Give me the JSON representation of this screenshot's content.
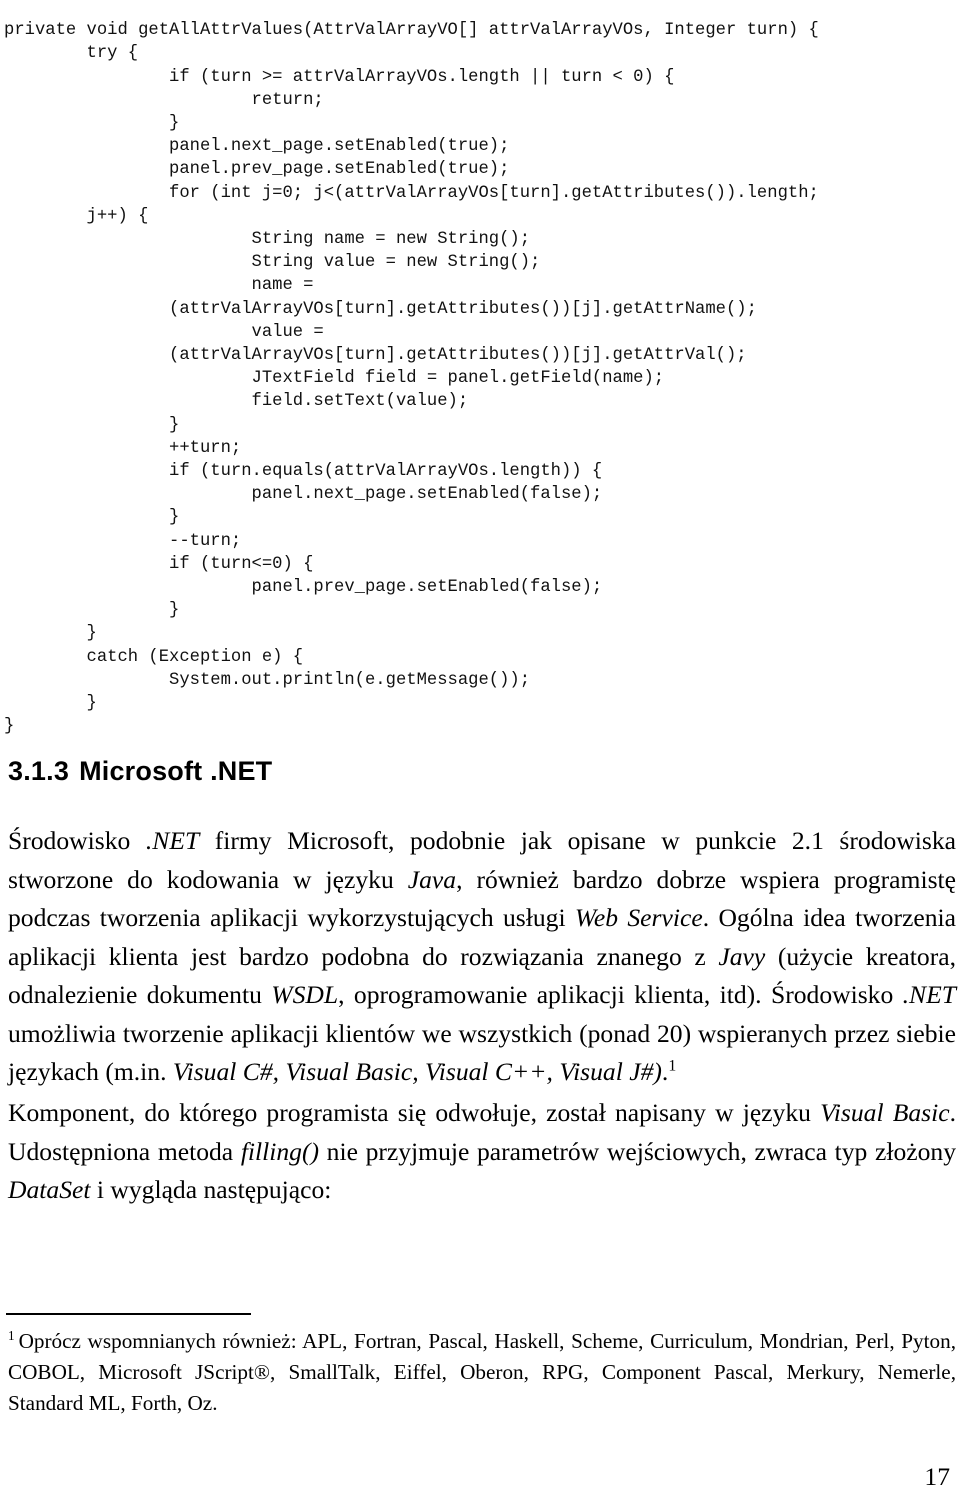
{
  "document": {
    "page_number": "17"
  },
  "code_listing": {
    "language": "java",
    "lines": [
      "private void getAllAttrValues(AttrValArrayVO[] attrValArrayVOs, Integer turn) {",
      "        try {",
      "                if (turn >= attrValArrayVOs.length || turn < 0) {",
      "                        return;",
      "                }",
      "                panel.next_page.setEnabled(true);",
      "                panel.prev_page.setEnabled(true);",
      "                for (int j=0; j<(attrValArrayVOs[turn].getAttributes()).length;",
      "        j++) {",
      "                        String name = new String();",
      "                        String value = new String();",
      "                        name =",
      "                (attrValArrayVOs[turn].getAttributes())[j].getAttrName();",
      "                        value =",
      "                (attrValArrayVOs[turn].getAttributes())[j].getAttrVal();",
      "                        JTextField field = panel.getField(name);",
      "                        field.setText(value);",
      "                }",
      "                ++turn;",
      "                if (turn.equals(attrValArrayVOs.length)) {",
      "                        panel.next_page.setEnabled(false);",
      "                }",
      "                --turn;",
      "                if (turn<=0) {",
      "                        panel.prev_page.setEnabled(false);",
      "                }",
      "        }",
      "        catch (Exception e) {",
      "                System.out.println(e.getMessage());",
      "        }",
      "}"
    ]
  },
  "heading": {
    "number": "3.1.3",
    "title": "Microsoft .NET"
  },
  "paragraphs": {
    "p1": {
      "segments": [
        {
          "text": "Środowisko ",
          "style": "normal"
        },
        {
          "text": ".NET",
          "style": "italic"
        },
        {
          "text": " firmy Microsoft, podobnie jak opisane w punkcie 2.1 środowiska stworzone do kodowania w języku ",
          "style": "normal"
        },
        {
          "text": "Java",
          "style": "italic"
        },
        {
          "text": ", również bardzo dobrze wspiera programistę podczas tworzenia aplikacji wykorzystujących usługi ",
          "style": "normal"
        },
        {
          "text": "Web Service",
          "style": "italic"
        },
        {
          "text": ". Ogólna idea tworzenia aplikacji klienta jest bardzo podobna do rozwiązania znanego z ",
          "style": "normal"
        },
        {
          "text": "Javy",
          "style": "italic"
        },
        {
          "text": " (użycie kreatora, odnalezienie dokumentu ",
          "style": "normal"
        },
        {
          "text": "WSDL",
          "style": "italic"
        },
        {
          "text": ", oprogramowanie aplikacji klienta, itd). Środowisko ",
          "style": "normal"
        },
        {
          "text": ".NET",
          "style": "italic"
        },
        {
          "text": " umożliwia tworzenie aplikacji klientów we wszystkich (ponad 20) wspieranych przez siebie językach (m.in. ",
          "style": "normal"
        },
        {
          "text": "Visual C#, Visual Basic, Visual C++, Visual J#)",
          "style": "italic"
        },
        {
          "text": ".",
          "style": "normal"
        },
        {
          "text": "1",
          "style": "superscript"
        }
      ]
    },
    "p2": {
      "segments": [
        {
          "text": "Komponent, do którego programista się odwołuje, został napisany w języku ",
          "style": "normal"
        },
        {
          "text": "Visual Basic",
          "style": "italic"
        },
        {
          "text": ". Udostępniona metoda ",
          "style": "normal"
        },
        {
          "text": "filling()",
          "style": "italic"
        },
        {
          "text": " nie przyjmuje parametrów wejściowych, zwraca typ złożony ",
          "style": "normal"
        },
        {
          "text": "DataSet",
          "style": "italic"
        },
        {
          "text": " i wygląda następująco:",
          "style": "normal"
        }
      ]
    }
  },
  "footnote": {
    "marker": "1",
    "text": "Oprócz wspomnianych również: APL, Fortran, Pascal, Haskell, Scheme, Curriculum, Mondrian, Perl, Pyton, COBOL, Microsoft JScript®, SmallTalk, Eiffel, Oberon, RPG, Component Pascal, Merkury, Nemerle, Standard ML, Forth, Oz."
  }
}
